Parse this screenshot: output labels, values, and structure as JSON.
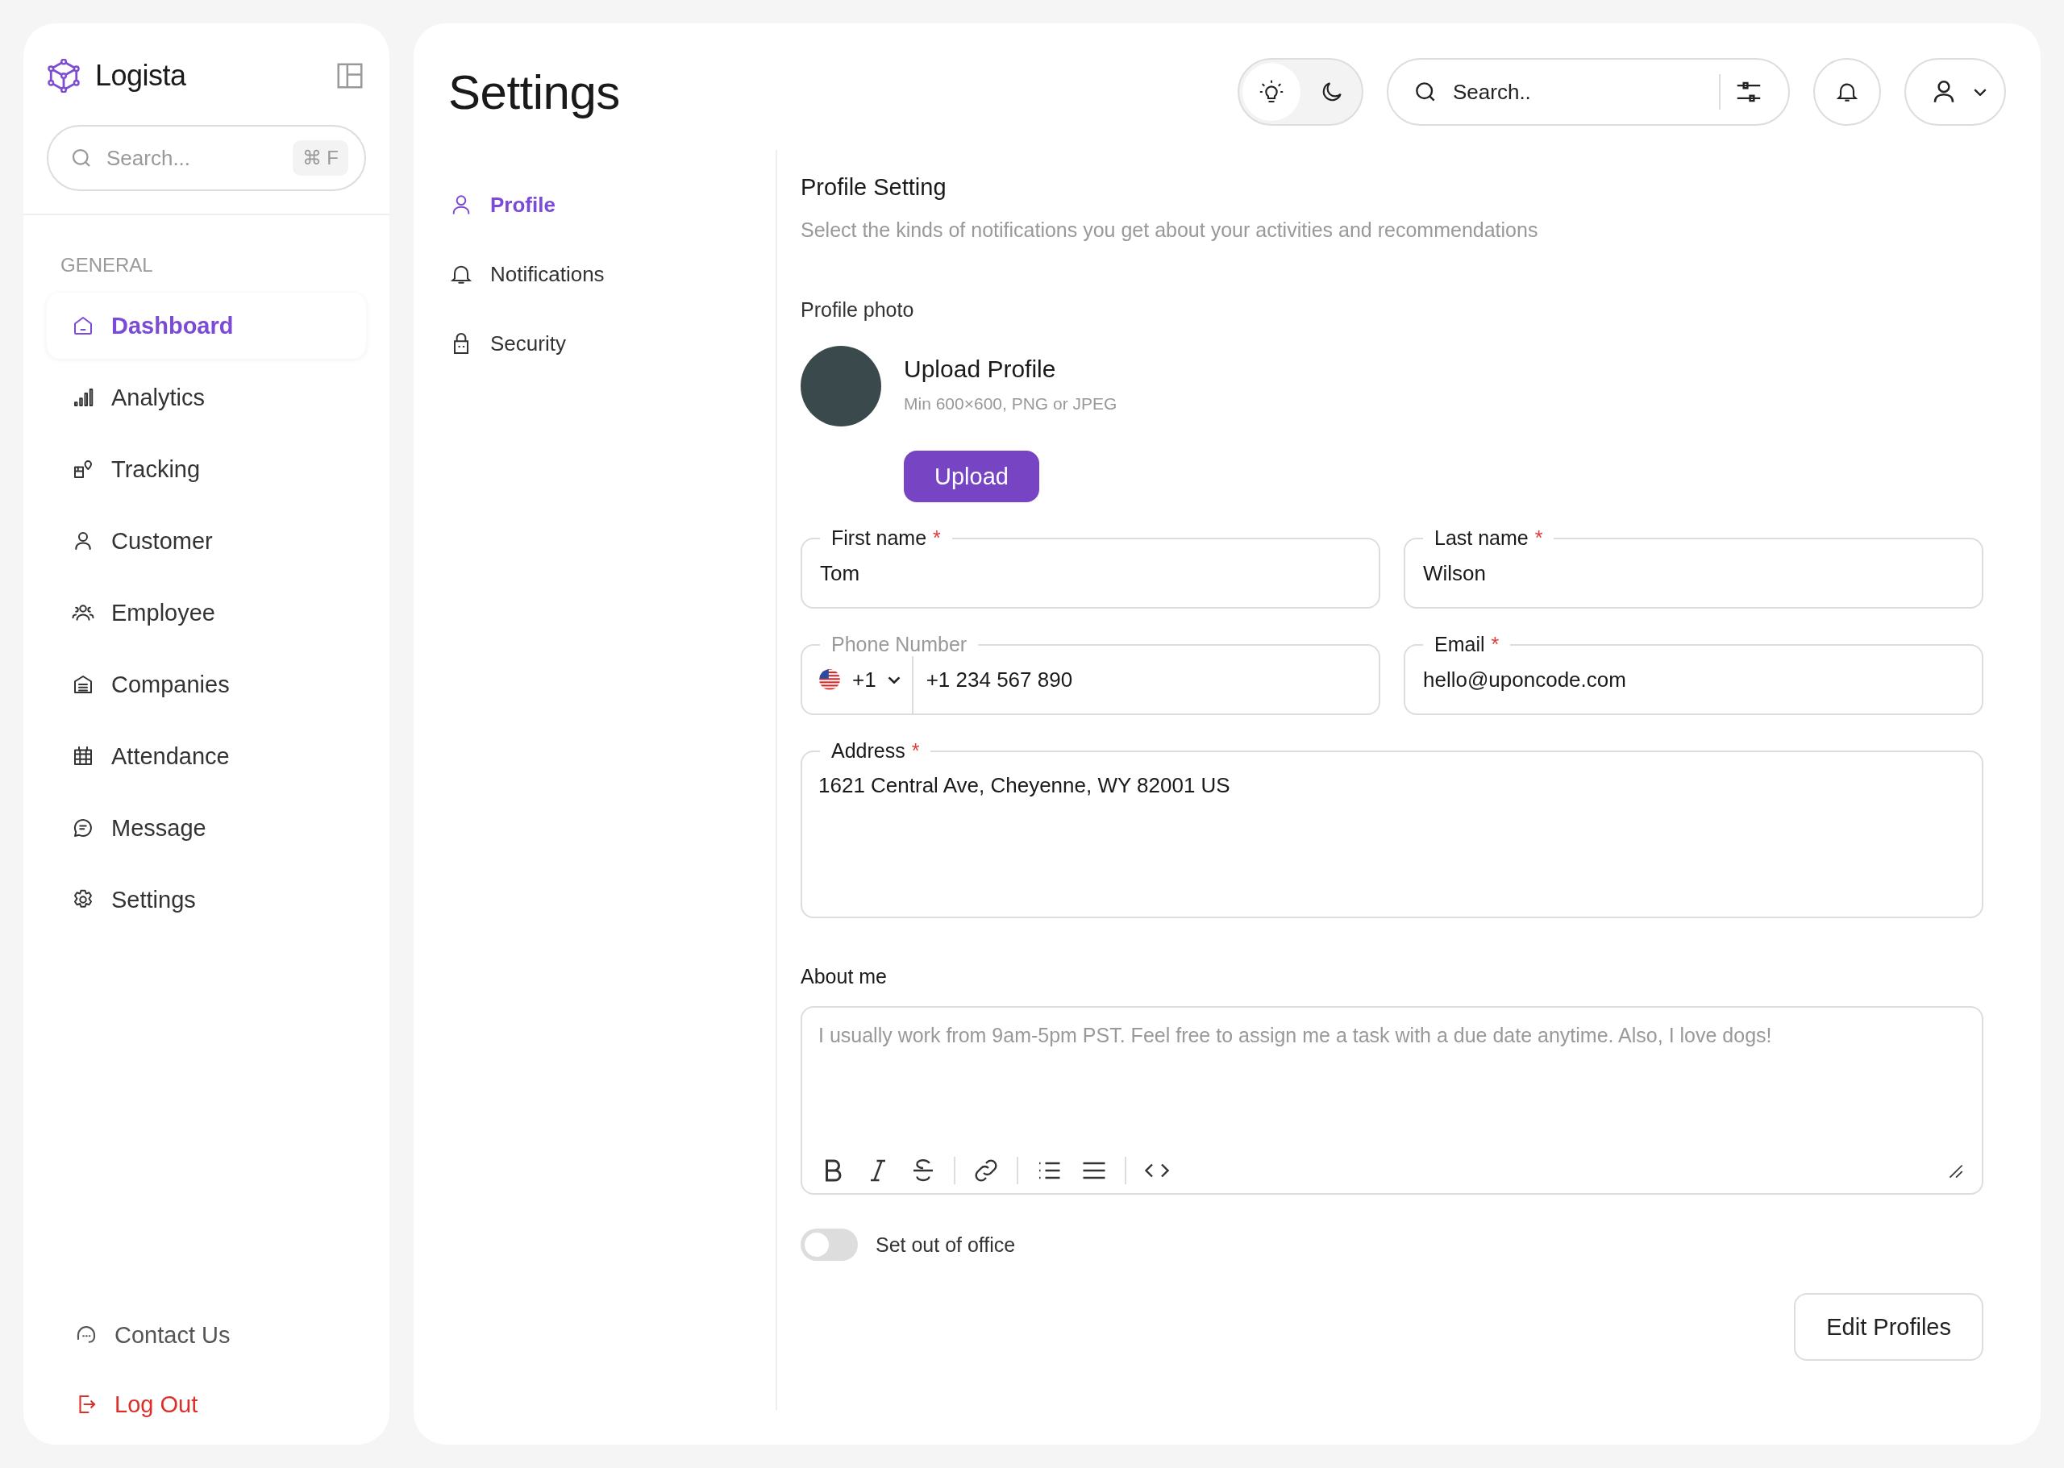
{
  "sidebar": {
    "brand": "Logista",
    "search": {
      "placeholder": "Search...",
      "shortcut": "⌘ F"
    },
    "section": "GENERAL",
    "items": [
      {
        "label": "Dashboard",
        "selected": true
      },
      {
        "label": "Analytics",
        "selected": false
      },
      {
        "label": "Tracking",
        "selected": false
      },
      {
        "label": "Customer",
        "selected": false
      },
      {
        "label": "Employee",
        "selected": false
      },
      {
        "label": "Companies",
        "selected": false
      },
      {
        "label": "Attendance",
        "selected": false
      },
      {
        "label": "Message",
        "selected": false
      },
      {
        "label": "Settings",
        "selected": false
      }
    ],
    "footer": [
      {
        "label": "Contact Us",
        "kind": "contact"
      },
      {
        "label": "Log Out",
        "kind": "logout"
      }
    ]
  },
  "header": {
    "title": "Settings",
    "theme": [
      {
        "kind": "light",
        "selected": true
      },
      {
        "kind": "dark",
        "selected": false
      }
    ],
    "search": {
      "placeholder": "Search.."
    }
  },
  "subnav": [
    {
      "label": "Profile",
      "selected": true
    },
    {
      "label": "Notifications",
      "selected": false
    },
    {
      "label": "Security",
      "selected": false
    }
  ],
  "profile": {
    "title": "Profile Setting",
    "description": "Select the kinds of notifications you get about your activities and recommendations",
    "photo_label": "Profile photo",
    "upload_title": "Upload Profile",
    "upload_hint": "Min 600×600, PNG or JPEG",
    "upload_button": "Upload",
    "fields": [
      {
        "label": "First name",
        "required": true,
        "mark": "*",
        "kind": "text",
        "value": "Tom"
      },
      {
        "label": "Last name",
        "required": true,
        "mark": "*",
        "kind": "text",
        "value": "Wilson"
      },
      {
        "label": "Phone Number",
        "required": false,
        "kind": "phone",
        "country_code": "+1",
        "value": "+1 234 567 890"
      },
      {
        "label": "Email",
        "required": true,
        "mark": "*",
        "kind": "text",
        "value": "hello@uponcode.com"
      },
      {
        "label": "Address",
        "required": true,
        "mark": "*",
        "kind": "textarea",
        "value": "1621 Central Ave, Cheyenne, WY 82001 US"
      }
    ],
    "about": {
      "label": "About me",
      "placeholder": "I usually work from 9am-5pm PST. Feel free to assign me a task with a due date anytime. Also, I love dogs!"
    },
    "out_of_office": {
      "label": "Set out of office",
      "on": false
    },
    "edit_button": "Edit Profiles"
  }
}
